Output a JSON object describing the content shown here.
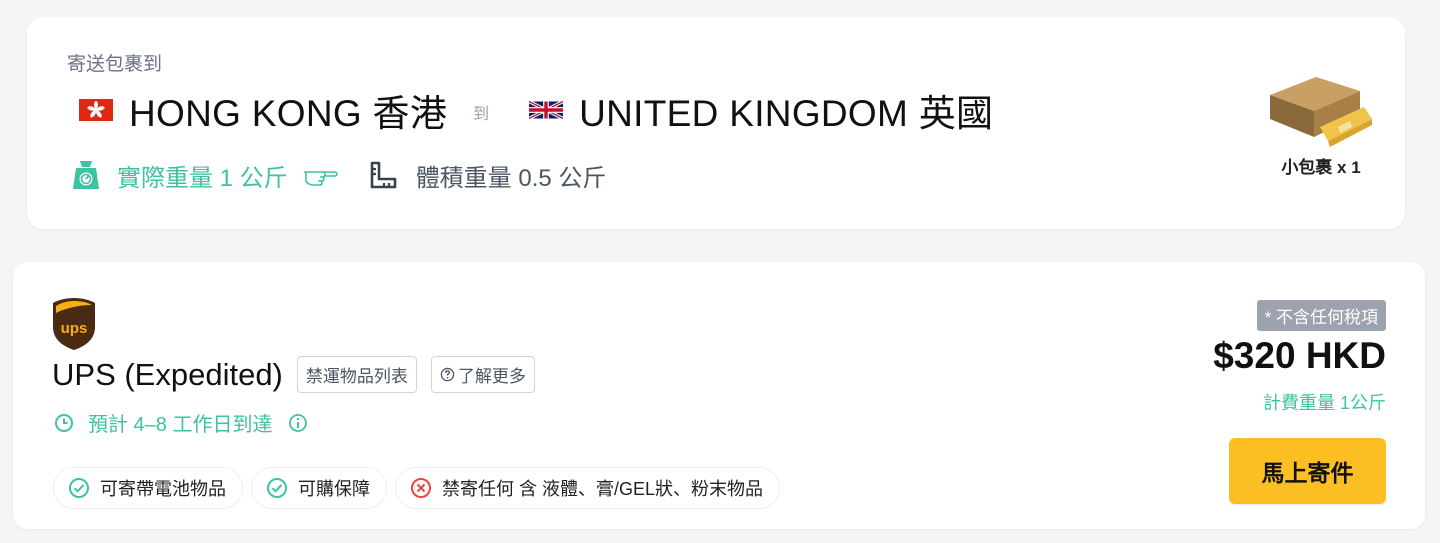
{
  "route": {
    "caption": "寄送包裹到",
    "origin": "HONG KONG 香港",
    "to_word": "到",
    "destination": "UNITED KINGDOM 英國",
    "actual_weight": "實際重量 1 公斤",
    "volumetric_weight": "體積重量 0.5 公斤",
    "package_label": "小包裹 x 1",
    "icons": {
      "origin_flag": "hong-kong-flag-icon",
      "destination_flag": "uk-flag-icon",
      "actual_weight": "scale-icon",
      "pointer": "pointing-hand-icon",
      "volumetric": "ruler-icon",
      "package": "parcel-box-icon"
    }
  },
  "carrier": {
    "logo": "ups-logo-icon",
    "name": "UPS (Expedited)",
    "prohibited_list_label": "禁運物品列表",
    "learn_more_label": "了解更多",
    "eta": "預計 4–8 工作日到達",
    "features": [
      {
        "label": "可寄帶電池物品",
        "status": "allowed",
        "icon": "check-circle-icon"
      },
      {
        "label": "可購保障",
        "status": "allowed",
        "icon": "check-circle-icon"
      },
      {
        "label": "禁寄任何 含 液體、膏/GEL狀、粉末物品",
        "status": "prohibited",
        "icon": "cross-circle-icon"
      }
    ],
    "tax_note": "* 不含任何稅項",
    "price": "$320 HKD",
    "billing_weight": "計費重量 1公斤",
    "ship_button": "馬上寄件"
  },
  "colors": {
    "accent_green": "#3ec2a1",
    "error_red": "#ef4444",
    "button_yellow": "#fbbf24",
    "ups_brown": "#4a2a12",
    "ups_gold": "#f5b014"
  }
}
